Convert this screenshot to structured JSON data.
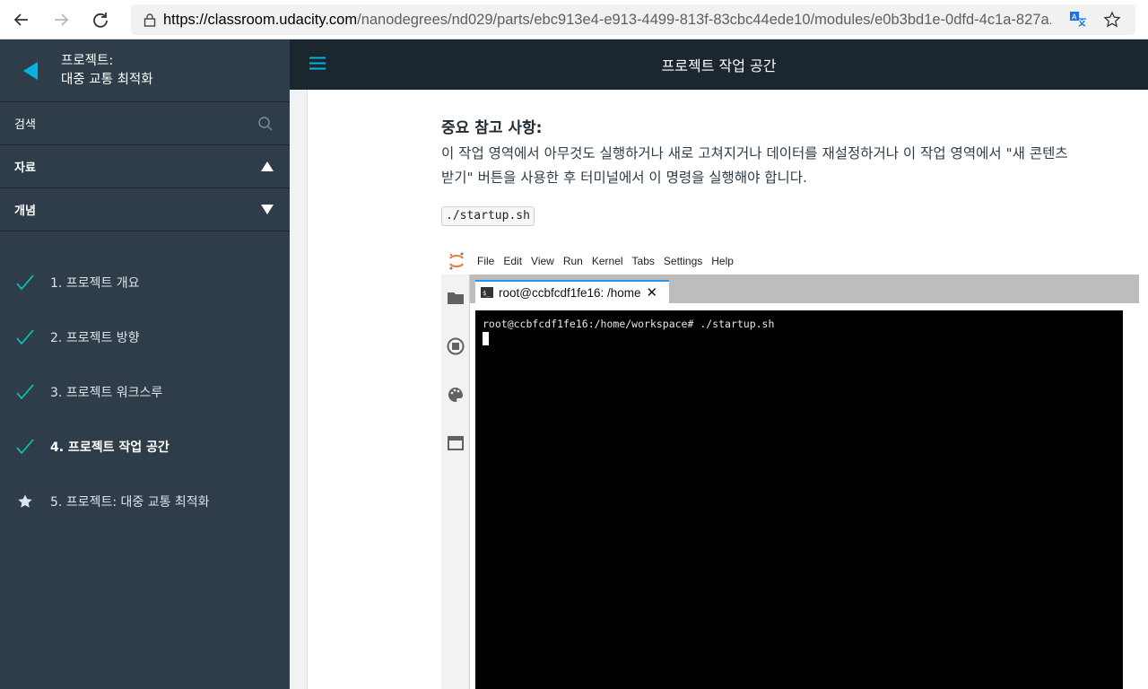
{
  "browser": {
    "url_domain": "https://classroom.udacity.com",
    "url_rest": "/nanodegrees/nd029/parts/ebc913e4-e913-4499-813f-83cbc44ede10/modules/e0b3bd1e-0dfd-4c1a-827a..."
  },
  "sidebar": {
    "title_line1": "프로젝트:",
    "title_line2": "대중 교통 최적화",
    "search_label": "검색",
    "resources_label": "자료",
    "concepts_label": "개념",
    "concepts": [
      {
        "label": "1. 프로젝트 개요",
        "status": "done"
      },
      {
        "label": "2. 프로젝트 방향",
        "status": "done"
      },
      {
        "label": "3. 프로젝트 워크스루",
        "status": "done"
      },
      {
        "label": "4. 프로젝트 작업 공간",
        "status": "done"
      },
      {
        "label": "5. 프로젝트: 대중 교통 최적화",
        "status": "project"
      }
    ]
  },
  "header": {
    "title": "프로젝트 작업 공간"
  },
  "content": {
    "note_title": "중요 참고 사항:",
    "note_line1": "이 작업 영역에서 아무것도 실행하거나 새로 고쳐지거나 데이터를 재설정하거나 이 작업 영역에서 \"새 콘텐츠",
    "note_line2": "받기\" 버튼을 사용한 후 터미널에서 이 명령을 실행해야 합니다.",
    "code": "./startup.sh"
  },
  "jupyter": {
    "menu": [
      "File",
      "Edit",
      "View",
      "Run",
      "Kernel",
      "Tabs",
      "Settings",
      "Help"
    ],
    "tab_label": "root@ccbfcdf1fe16: /home",
    "terminal_line": "root@ccbfcdf1fe16:/home/workspace# ./startup.sh"
  },
  "colors": {
    "accent": "#02b3e4",
    "check": "#02ccba",
    "sidebar_bg": "#2e3d49",
    "header_bg": "#1c262f"
  }
}
